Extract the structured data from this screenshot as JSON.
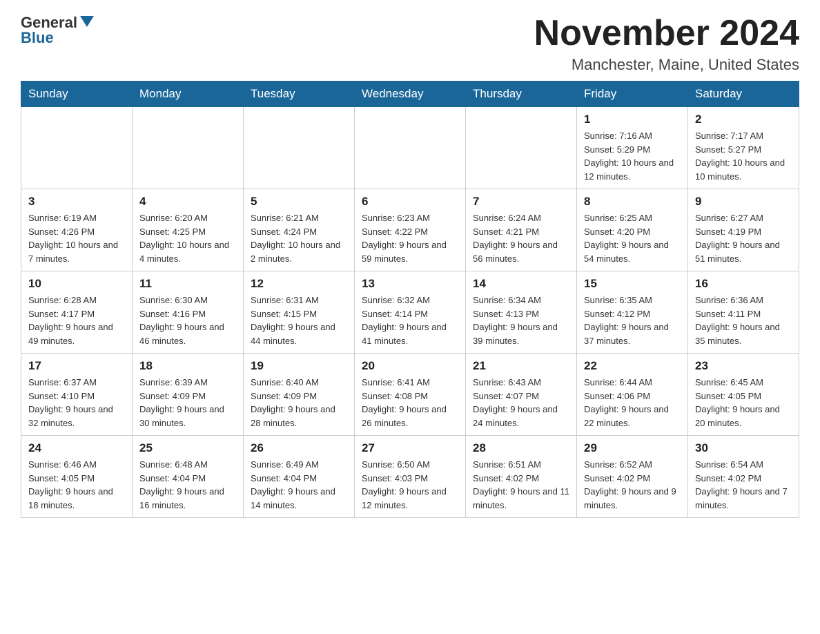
{
  "header": {
    "logo_text": "General",
    "logo_blue": "Blue",
    "month_title": "November 2024",
    "location": "Manchester, Maine, United States"
  },
  "days_of_week": [
    "Sunday",
    "Monday",
    "Tuesday",
    "Wednesday",
    "Thursday",
    "Friday",
    "Saturday"
  ],
  "weeks": [
    [
      {
        "day": "",
        "info": ""
      },
      {
        "day": "",
        "info": ""
      },
      {
        "day": "",
        "info": ""
      },
      {
        "day": "",
        "info": ""
      },
      {
        "day": "",
        "info": ""
      },
      {
        "day": "1",
        "info": "Sunrise: 7:16 AM\nSunset: 5:29 PM\nDaylight: 10 hours and 12 minutes."
      },
      {
        "day": "2",
        "info": "Sunrise: 7:17 AM\nSunset: 5:27 PM\nDaylight: 10 hours and 10 minutes."
      }
    ],
    [
      {
        "day": "3",
        "info": "Sunrise: 6:19 AM\nSunset: 4:26 PM\nDaylight: 10 hours and 7 minutes."
      },
      {
        "day": "4",
        "info": "Sunrise: 6:20 AM\nSunset: 4:25 PM\nDaylight: 10 hours and 4 minutes."
      },
      {
        "day": "5",
        "info": "Sunrise: 6:21 AM\nSunset: 4:24 PM\nDaylight: 10 hours and 2 minutes."
      },
      {
        "day": "6",
        "info": "Sunrise: 6:23 AM\nSunset: 4:22 PM\nDaylight: 9 hours and 59 minutes."
      },
      {
        "day": "7",
        "info": "Sunrise: 6:24 AM\nSunset: 4:21 PM\nDaylight: 9 hours and 56 minutes."
      },
      {
        "day": "8",
        "info": "Sunrise: 6:25 AM\nSunset: 4:20 PM\nDaylight: 9 hours and 54 minutes."
      },
      {
        "day": "9",
        "info": "Sunrise: 6:27 AM\nSunset: 4:19 PM\nDaylight: 9 hours and 51 minutes."
      }
    ],
    [
      {
        "day": "10",
        "info": "Sunrise: 6:28 AM\nSunset: 4:17 PM\nDaylight: 9 hours and 49 minutes."
      },
      {
        "day": "11",
        "info": "Sunrise: 6:30 AM\nSunset: 4:16 PM\nDaylight: 9 hours and 46 minutes."
      },
      {
        "day": "12",
        "info": "Sunrise: 6:31 AM\nSunset: 4:15 PM\nDaylight: 9 hours and 44 minutes."
      },
      {
        "day": "13",
        "info": "Sunrise: 6:32 AM\nSunset: 4:14 PM\nDaylight: 9 hours and 41 minutes."
      },
      {
        "day": "14",
        "info": "Sunrise: 6:34 AM\nSunset: 4:13 PM\nDaylight: 9 hours and 39 minutes."
      },
      {
        "day": "15",
        "info": "Sunrise: 6:35 AM\nSunset: 4:12 PM\nDaylight: 9 hours and 37 minutes."
      },
      {
        "day": "16",
        "info": "Sunrise: 6:36 AM\nSunset: 4:11 PM\nDaylight: 9 hours and 35 minutes."
      }
    ],
    [
      {
        "day": "17",
        "info": "Sunrise: 6:37 AM\nSunset: 4:10 PM\nDaylight: 9 hours and 32 minutes."
      },
      {
        "day": "18",
        "info": "Sunrise: 6:39 AM\nSunset: 4:09 PM\nDaylight: 9 hours and 30 minutes."
      },
      {
        "day": "19",
        "info": "Sunrise: 6:40 AM\nSunset: 4:09 PM\nDaylight: 9 hours and 28 minutes."
      },
      {
        "day": "20",
        "info": "Sunrise: 6:41 AM\nSunset: 4:08 PM\nDaylight: 9 hours and 26 minutes."
      },
      {
        "day": "21",
        "info": "Sunrise: 6:43 AM\nSunset: 4:07 PM\nDaylight: 9 hours and 24 minutes."
      },
      {
        "day": "22",
        "info": "Sunrise: 6:44 AM\nSunset: 4:06 PM\nDaylight: 9 hours and 22 minutes."
      },
      {
        "day": "23",
        "info": "Sunrise: 6:45 AM\nSunset: 4:05 PM\nDaylight: 9 hours and 20 minutes."
      }
    ],
    [
      {
        "day": "24",
        "info": "Sunrise: 6:46 AM\nSunset: 4:05 PM\nDaylight: 9 hours and 18 minutes."
      },
      {
        "day": "25",
        "info": "Sunrise: 6:48 AM\nSunset: 4:04 PM\nDaylight: 9 hours and 16 minutes."
      },
      {
        "day": "26",
        "info": "Sunrise: 6:49 AM\nSunset: 4:04 PM\nDaylight: 9 hours and 14 minutes."
      },
      {
        "day": "27",
        "info": "Sunrise: 6:50 AM\nSunset: 4:03 PM\nDaylight: 9 hours and 12 minutes."
      },
      {
        "day": "28",
        "info": "Sunrise: 6:51 AM\nSunset: 4:02 PM\nDaylight: 9 hours and 11 minutes."
      },
      {
        "day": "29",
        "info": "Sunrise: 6:52 AM\nSunset: 4:02 PM\nDaylight: 9 hours and 9 minutes."
      },
      {
        "day": "30",
        "info": "Sunrise: 6:54 AM\nSunset: 4:02 PM\nDaylight: 9 hours and 7 minutes."
      }
    ]
  ]
}
